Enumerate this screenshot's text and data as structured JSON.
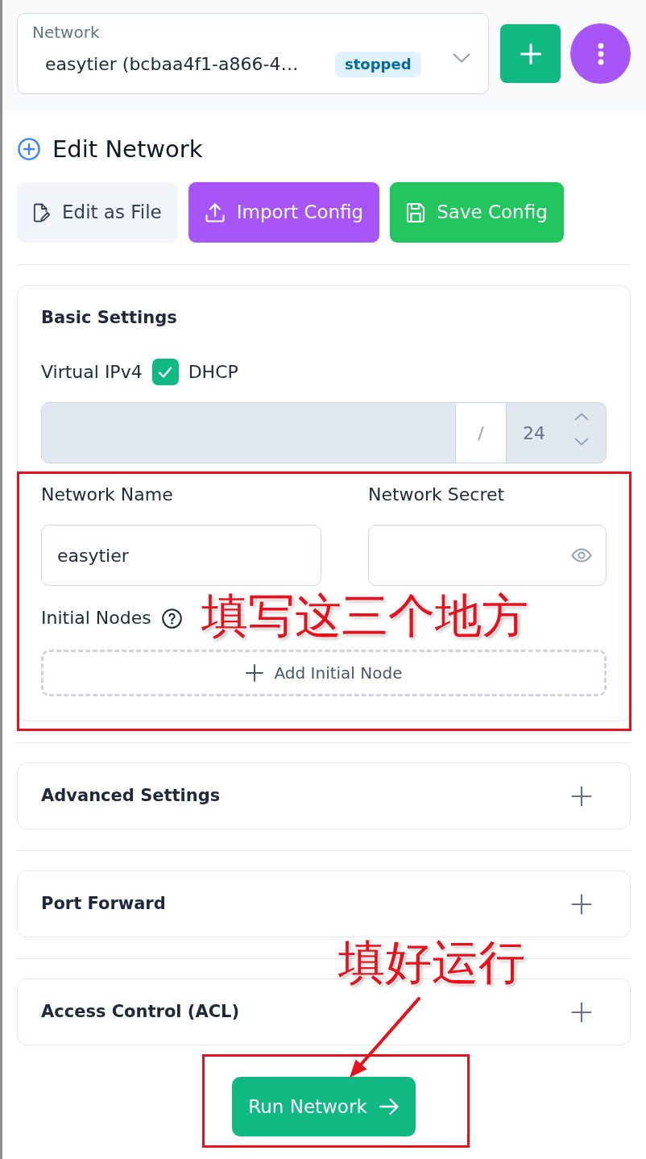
{
  "network_selector": {
    "label": "Network",
    "value": "easytier (bcbaa4f1-a866-4…",
    "status": "stopped"
  },
  "editor": {
    "title": "Edit Network",
    "actions": [
      {
        "kind": "edit",
        "label": "Edit as File"
      },
      {
        "kind": "import",
        "label": "Import Config"
      },
      {
        "kind": "save",
        "label": "Save Config"
      }
    ]
  },
  "basic_settings": {
    "title": "Basic Settings",
    "virtual_ipv4": {
      "label": "Virtual IPv4",
      "dhcp": {
        "label": "DHCP",
        "checked": true
      },
      "separator": "/",
      "prefix_length": "24"
    },
    "network_name": {
      "label": "Network Name",
      "value": "easytier"
    },
    "network_secret": {
      "label": "Network Secret"
    },
    "initial_nodes": {
      "label": "Initial Nodes",
      "add_button": "Add Initial Node"
    }
  },
  "sections": [
    {
      "title": "Advanced Settings",
      "expanded": false
    },
    {
      "title": "Port Forward",
      "expanded": false
    },
    {
      "title": "Access Control (ACL)",
      "expanded": false
    }
  ],
  "run_button": {
    "label": "Run Network"
  },
  "annotations": [
    {
      "text": "填写这三个地方"
    },
    {
      "text": "填好运行"
    }
  ]
}
